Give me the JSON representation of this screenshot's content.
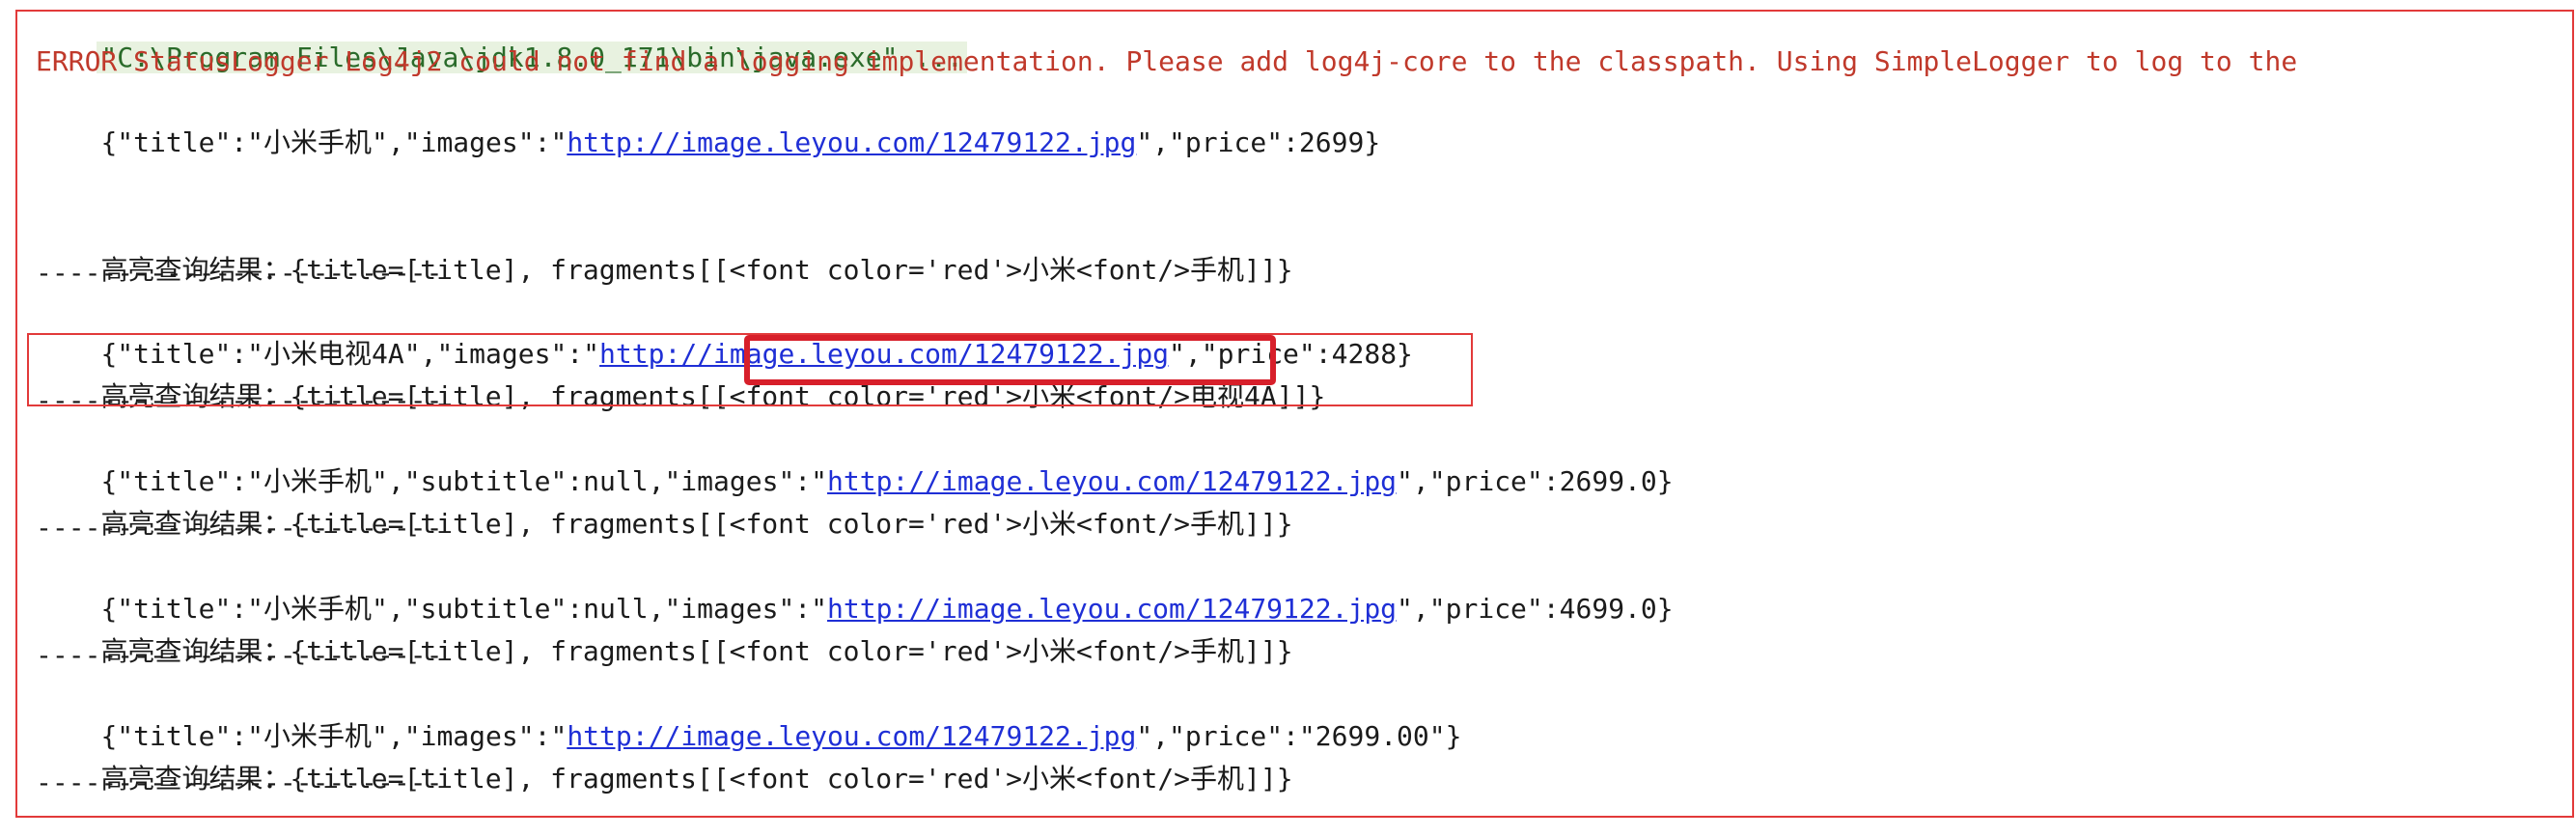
{
  "console": {
    "command_line": "\"C:\\Program Files\\Java\\jdk1.8.0_171\\bin\\java.exe\" ...",
    "error_line": "ERROR StatusLogger Log4j2 could not find a logging implementation. Please add log4j-core to the classpath. Using SimpleLogger to log to the",
    "highlight_prefix": "高亮查询结果：{title=[title], fragments[[",
    "highlight_tag": "<font color='red'>小米<font/>",
    "separator": "-------------------------",
    "entries": [
      {
        "json_pre": "{\"title\":\"小米手机\",\"images\":\"",
        "url": "http://image.leyou.com/12479122.jpg",
        "json_post": "\",\"price\":2699}",
        "highlight_rest": "手机]]}"
      },
      {
        "json_pre": "{\"title\":\"小米电视4A\",\"images\":\"",
        "url": "http://image.leyou.com/12479122.jpg",
        "json_post": "\",\"price\":4288}",
        "highlight_rest": "电视4A]]}"
      },
      {
        "json_pre": "{\"title\":\"小米手机\",\"subtitle\":null,\"images\":\"",
        "url": "http://image.leyou.com/12479122.jpg",
        "json_post": "\",\"price\":2699.0}",
        "highlight_rest": "手机]]}"
      },
      {
        "json_pre": "{\"title\":\"小米手机\",\"subtitle\":null,\"images\":\"",
        "url": "http://image.leyou.com/12479122.jpg",
        "json_post": "\",\"price\":4699.0}",
        "highlight_rest": "手机]]}"
      },
      {
        "json_pre": "{\"title\":\"小米手机\",\"images\":\"",
        "url": "http://image.leyou.com/12479122.jpg",
        "json_post": "\",\"price\":\"2699.00\"}",
        "highlight_rest": "手机]]}"
      }
    ]
  },
  "colors": {
    "frame": "#e23a3a",
    "highlight_box": "#d71f2a",
    "error_text": "#c0392b",
    "link": "#1f2fd6",
    "command_bg": "#e8f2e0"
  }
}
